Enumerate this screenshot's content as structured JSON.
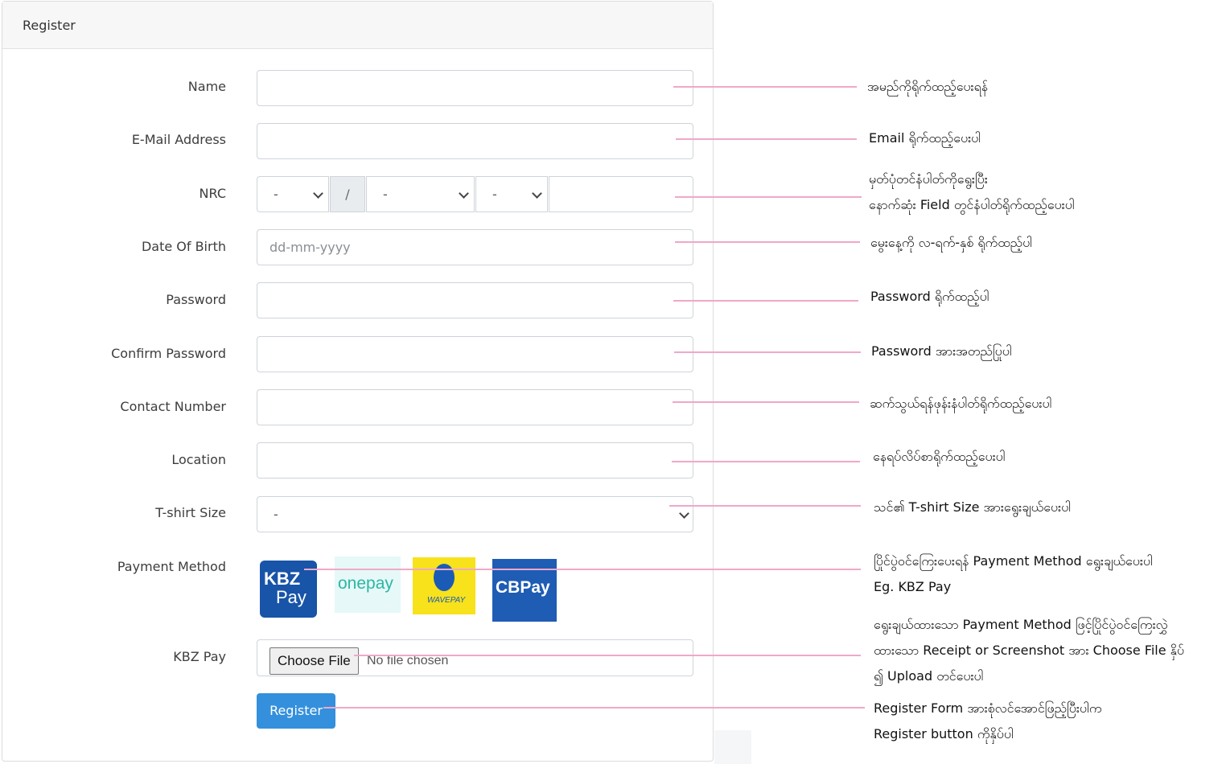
{
  "form": {
    "header_title": "Register",
    "labels": {
      "name": "Name",
      "email": "E-Mail Address",
      "nrc": "NRC",
      "dob": "Date Of Birth",
      "password": "Password",
      "confirm_password": "Confirm Password",
      "contact": "Contact Number",
      "location": "Location",
      "tshirt": "T-shirt Size",
      "payment": "Payment Method",
      "kbz": "KBZ Pay"
    },
    "dob_placeholder": "dd-mm-yyyy",
    "nrc": {
      "select1": "-",
      "slash": "/",
      "select2": "-",
      "select3": "-"
    },
    "tshirt_value": "-",
    "payment_logos": [
      {
        "name": "KBZ Pay",
        "line1": "KBZ",
        "line2": "Pay",
        "color": "#1854a8"
      },
      {
        "name": "onepay",
        "text": "onepay",
        "color": "#e6f8f8"
      },
      {
        "name": "WavePay",
        "text": "WAVEPAY",
        "color": "#f7e21b"
      },
      {
        "name": "CB Pay",
        "text": "CBPay",
        "color": "#1f5cb4"
      }
    ],
    "file": {
      "button": "Choose File",
      "status": "No file chosen"
    },
    "register_button": "Register"
  },
  "annotations": [
    {
      "lines": [
        "အမည်ကိုရိုက်ထည့်ပေးရန်"
      ]
    },
    {
      "lines": [
        "Email ရိုက်ထည့်ပေးပါ"
      ]
    },
    {
      "lines": [
        "မှတ်ပုံတင်နံပါတ်ကိုရွေးပြီး",
        "နောက်ဆုံး Field တွင်နံပါတ်ရိုက်ထည့်ပေးပါ"
      ]
    },
    {
      "lines": [
        "မွေးနေ့ကို လ-ရက်-နှစ် ရိုက်ထည့်ပါ"
      ]
    },
    {
      "lines": [
        "Password ရိုက်ထည့်ပါ"
      ]
    },
    {
      "lines": [
        "Password အားအတည်ပြုပါ"
      ]
    },
    {
      "lines": [
        "ဆက်သွယ်ရန်ဖုန်းနံပါတ်ရိုက်ထည့်ပေးပါ"
      ]
    },
    {
      "lines": [
        "နေရပ်လိပ်စာရိုက်ထည့်ပေးပါ"
      ]
    },
    {
      "lines": [
        "သင်၏ T-shirt Size အားရွေးချယ်ပေးပါ"
      ]
    },
    {
      "lines": [
        "ပြိုင်ပွဲဝင်ကြေးပေးရန် Payment Method ရွေးချယ်ပေးပါ",
        " Eg. KBZ Pay"
      ]
    },
    {
      "lines": [
        "ရွေးချယ်ထားသော Payment Method ဖြင့်ပြိုင်ပွဲဝင်ကြေးလွှဲ",
        "ထားသော Receipt or Screenshot အား Choose File နှိပ်",
        "၍  Upload တင်ပေးပါ"
      ]
    },
    {
      "lines": [
        "Register Form အားစုံလင်အောင်ဖြည့်ပြီးပါက",
        "Register button ကိုနှိပ်ပါ"
      ]
    }
  ],
  "colors": {
    "accent": "#3490dc",
    "annotation_line": "#f0a8c8"
  }
}
